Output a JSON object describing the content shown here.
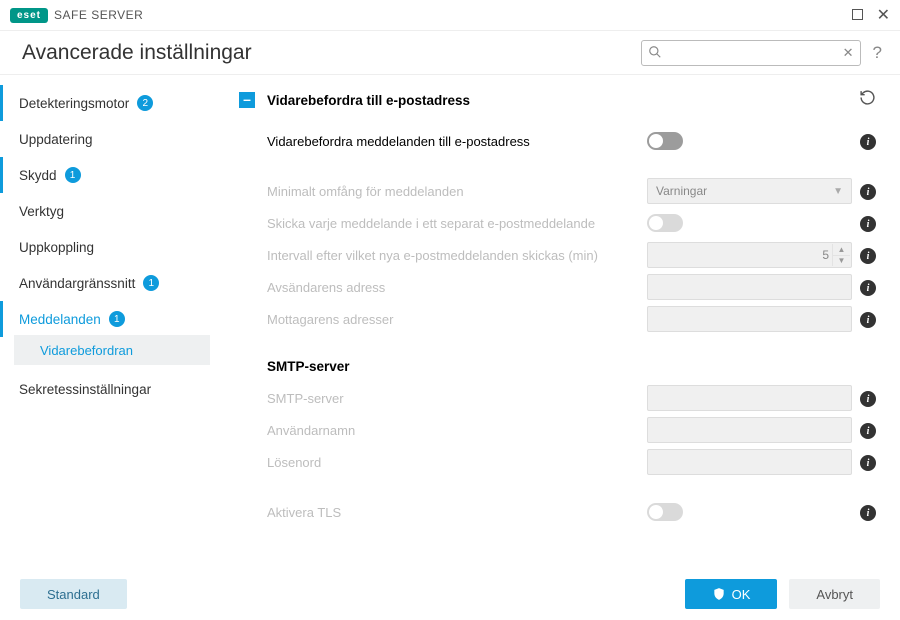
{
  "product": {
    "badge": "eset",
    "name": "SAFE SERVER"
  },
  "page_title": "Avancerade inställningar",
  "search": {
    "placeholder": ""
  },
  "sidebar": {
    "items": [
      {
        "label": "Detekteringsmotor",
        "badge": "2"
      },
      {
        "label": "Uppdatering"
      },
      {
        "label": "Skydd",
        "badge": "1"
      },
      {
        "label": "Verktyg"
      },
      {
        "label": "Uppkoppling"
      },
      {
        "label": "Användargränssnitt",
        "badge": "1"
      },
      {
        "label": "Meddelanden",
        "badge": "1"
      },
      {
        "label": "Sekretessinställningar"
      }
    ],
    "sub": "Vidarebefordran"
  },
  "section": {
    "title": "Vidarebefordra till e-postadress"
  },
  "rows": {
    "forward_enable": "Vidarebefordra meddelanden till e-postadress",
    "min_verbosity": "Minimalt omfång för meddelanden",
    "min_verbosity_value": "Varningar",
    "separate": "Skicka varje meddelande i ett separat e-postmeddelande",
    "interval": "Intervall efter vilket nya e-postmeddelanden skickas (min)",
    "interval_value": "5",
    "sender": "Avsändarens adress",
    "recipients": "Mottagarens adresser"
  },
  "smtp": {
    "header": "SMTP-server",
    "server": "SMTP-server",
    "user": "Användarnamn",
    "pass": "Lösenord",
    "tls": "Aktivera TLS"
  },
  "footer": {
    "default": "Standard",
    "ok": "OK",
    "cancel": "Avbryt"
  }
}
